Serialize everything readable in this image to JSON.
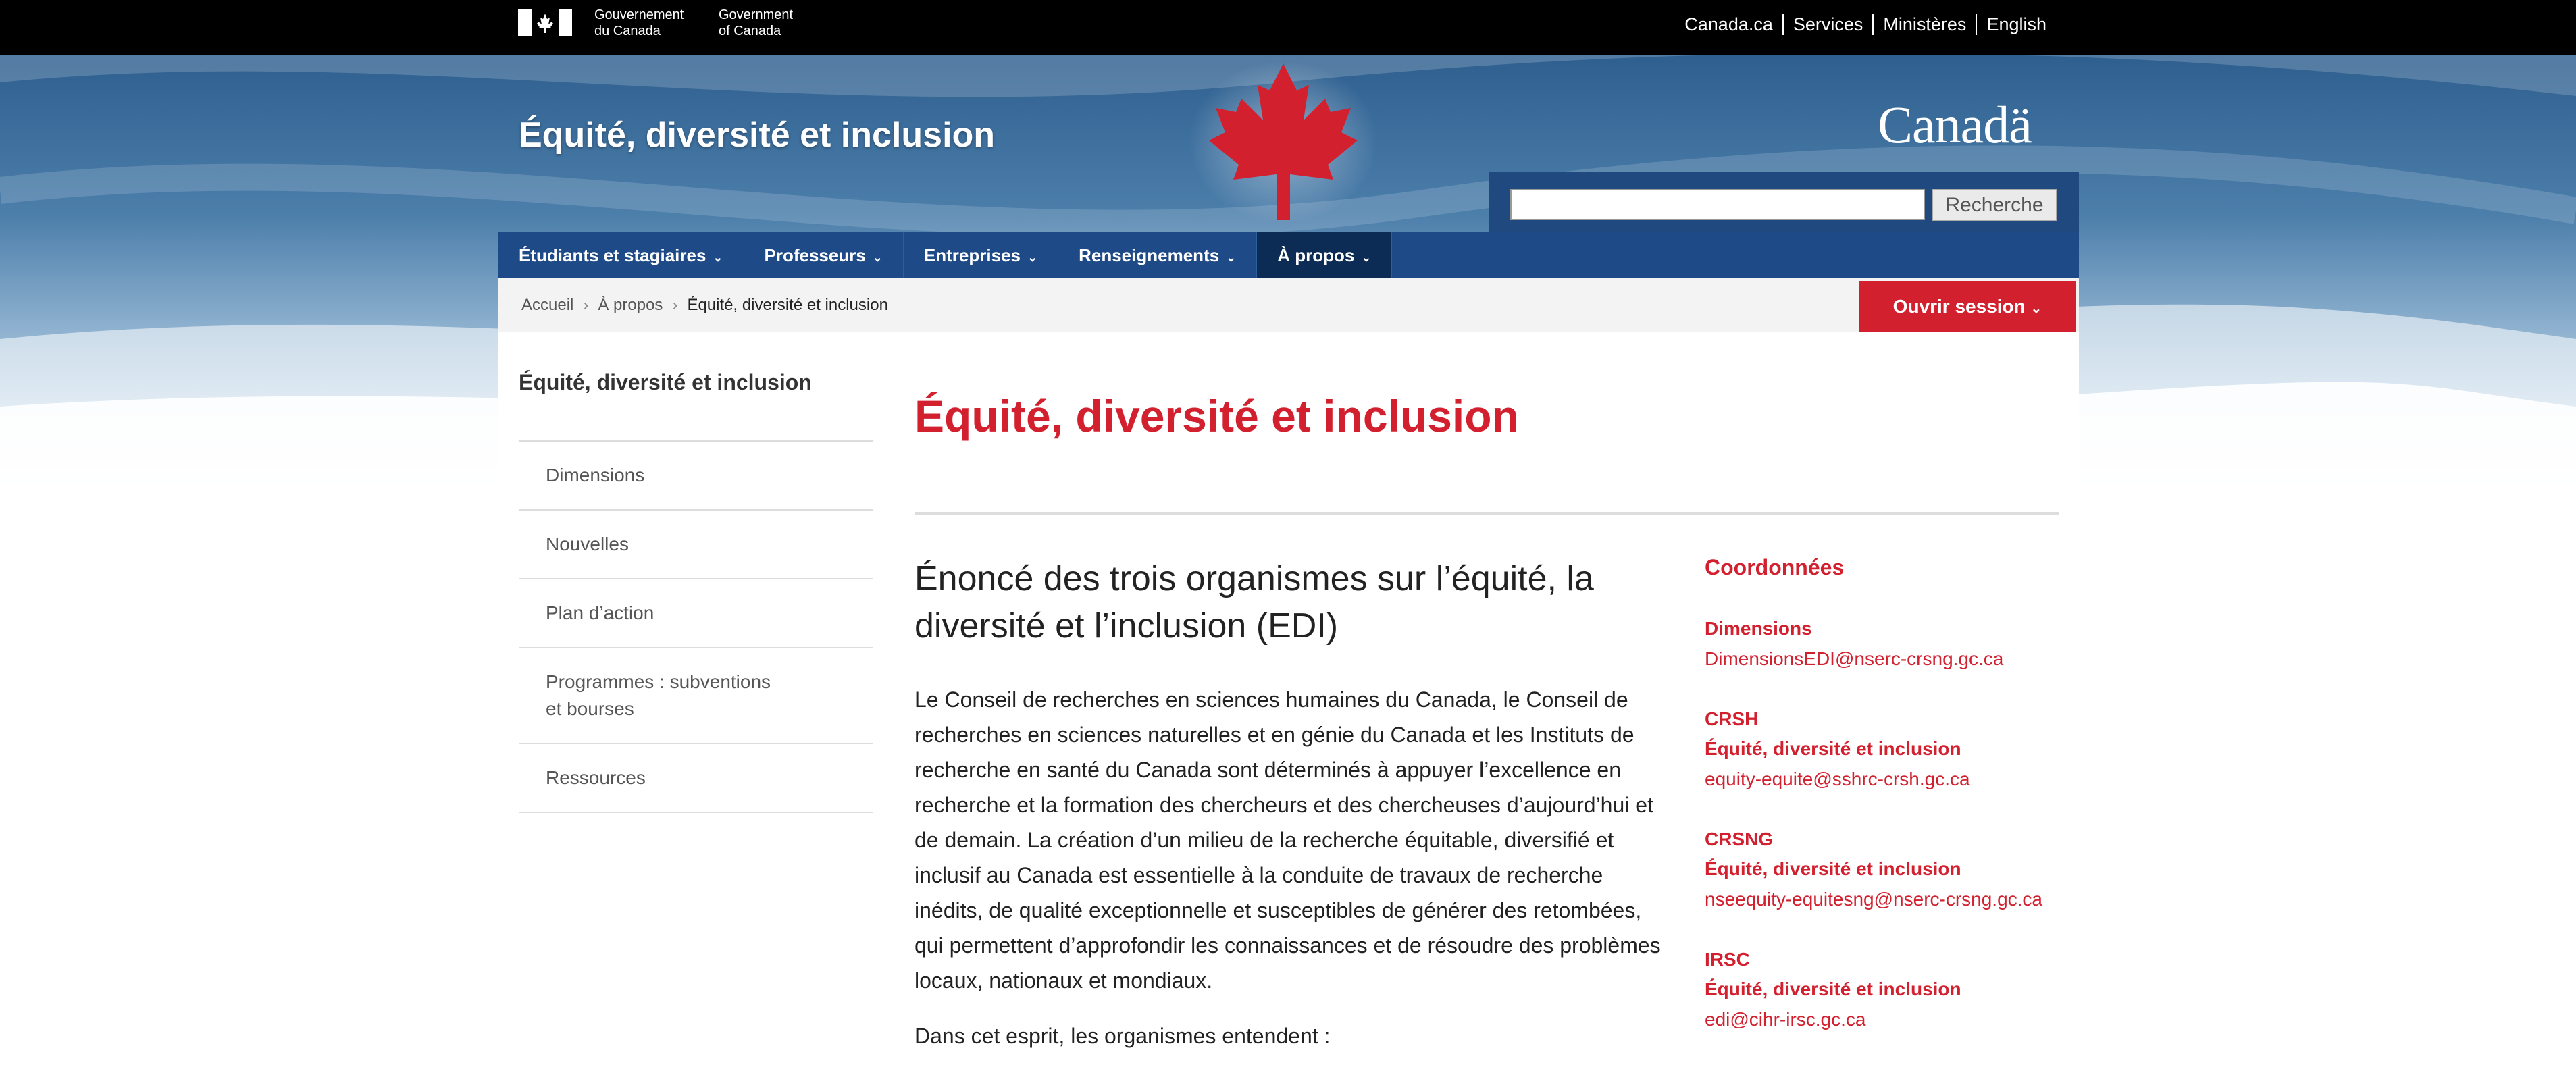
{
  "fip": {
    "gov_fr": [
      "Gouvernement",
      "du Canada"
    ],
    "gov_en": [
      "Government",
      "of Canada"
    ],
    "links": [
      "Canada.ca",
      "Services",
      "Ministères",
      "English"
    ]
  },
  "header": {
    "site_title": "Équité, diversité et inclusion",
    "wordmark": "Canadä",
    "search_placeholder": "",
    "search_button": "Recherche"
  },
  "nav": {
    "items": [
      "Étudiants et stagiaires",
      "Professeurs",
      "Entreprises",
      "Renseignements",
      "À propos"
    ],
    "active": "À propos"
  },
  "breadcrumb": {
    "items": [
      "Accueil",
      "À propos",
      "Équité, diversité et inclusion"
    ]
  },
  "login_button": "Ouvrir session",
  "sidebar": {
    "title": "Équité, diversité et inclusion",
    "items": [
      "Dimensions",
      "Nouvelles",
      "Plan d’action",
      "Programmes : subventions et bourses",
      "Ressources"
    ]
  },
  "main": {
    "title": "Équité, diversité et inclusion",
    "subtitle": "Énoncé des trois organismes sur l’équité, la diversité et l’inclusion (EDI)",
    "paragraph": "Le Conseil de recherches en sciences humaines du Canada, le Conseil de recherches en sciences naturelles et en génie du Canada et les Instituts de recherche en santé du Canada sont déterminés à appuyer l’excellence en recherche et la formation des chercheurs et des chercheuses d’aujourd’hui et de demain. La création d’un milieu de la recherche équitable, diversifié et inclusif au Canada est essentielle à la conduite de travaux de recherche inédits, de qualité exceptionnelle et susceptibles de générer des retombées, qui permettent d’approfondir les connaissances et de résoudre des problèmes locaux, nationaux et mondiaux.",
    "paragraph2": "Dans cet esprit, les organismes entendent :"
  },
  "contacts": {
    "heading": "Coordonnées",
    "blocks": [
      {
        "org": "Dimensions",
        "dept": "",
        "email": "DimensionsEDI@nserc-crsng.gc.ca"
      },
      {
        "org": "CRSH",
        "dept": "Équité, diversité et inclusion",
        "email": "equity-equite@sshrc-crsh.gc.ca"
      },
      {
        "org": "CRSNG",
        "dept": "Équité, diversité et inclusion",
        "email": "nseequity-equitesng@nserc-crsng.gc.ca"
      },
      {
        "org": "IRSC",
        "dept": "Équité, diversité et inclusion",
        "email": "edi@cihr-irsc.gc.ca"
      }
    ]
  },
  "colors": {
    "accent_red": "#d3202f",
    "nav_blue": "#1e4a87",
    "nav_active": "#0c2c55",
    "fip_black": "#000000"
  }
}
